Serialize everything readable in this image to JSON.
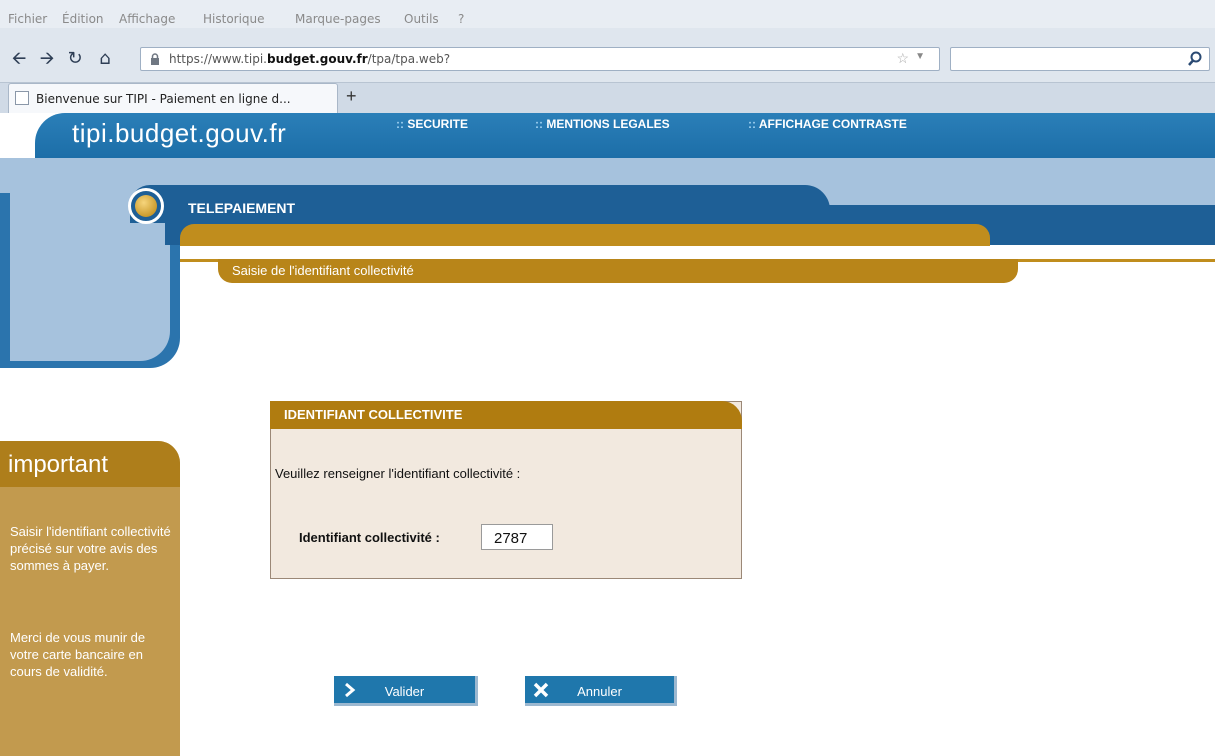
{
  "browser": {
    "menu": [
      "Fichier",
      "Édition",
      "Affichage",
      "Historique",
      "Marque-pages",
      "Outils",
      "?"
    ],
    "url_prefix": "https://www.tipi.",
    "url_domain": "budget.gouv.fr",
    "url_path": "/tpa/tpa.web?",
    "tab_title": "Bienvenue sur TIPI - Paiement en ligne d..."
  },
  "site": {
    "logo": "tipi.budget.gouv.fr",
    "toplinks": [
      "SECURITE",
      "MENTIONS LEGALES",
      "AFFICHAGE CONTRASTE"
    ],
    "section_title": "TELEPAIEMENT",
    "sub_title": "Saisie de l'identifiant collectivité",
    "box": {
      "title": "IDENTIFIANT COLLECTIVITE",
      "prompt": "Veuillez renseigner l'identifiant collectivité :",
      "label": "Identifiant collectivité :",
      "value": "2787"
    },
    "sidebar": {
      "title": "important",
      "para1": "Saisir l'identifiant collectivité précisé sur votre avis des sommes à payer.",
      "para2": "Merci de vous munir de votre carte bancaire en cours de validité."
    },
    "buttons": {
      "validate": "Valider",
      "cancel": "Annuler"
    }
  }
}
